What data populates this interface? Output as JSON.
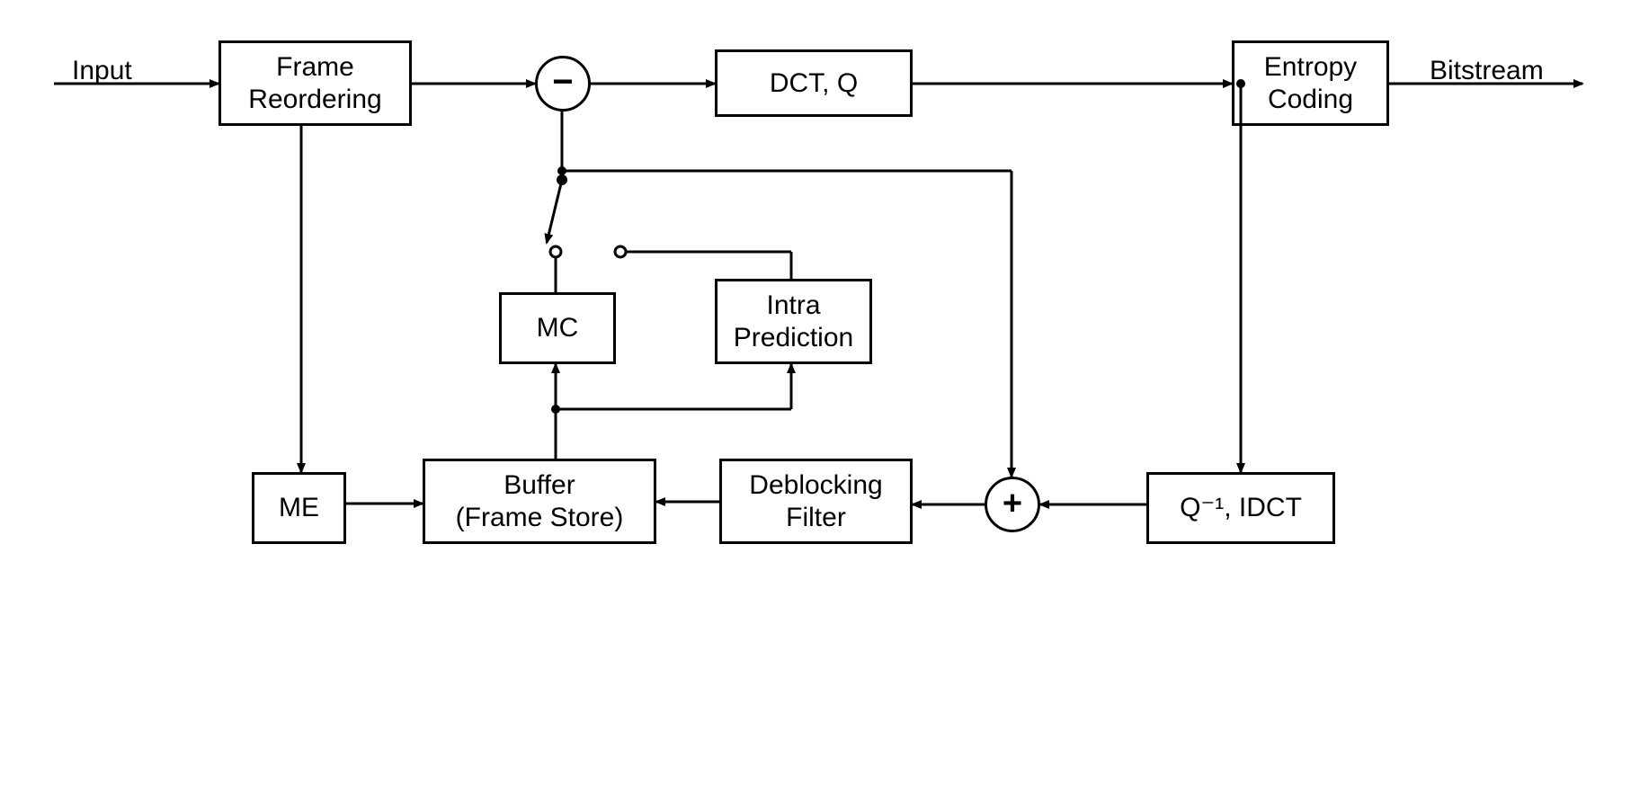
{
  "labels": {
    "input": "Input",
    "bitstream": "Bitstream"
  },
  "blocks": {
    "frameReordering": "Frame\nReordering",
    "dctQ": "DCT, Q",
    "entropyCoding": "Entropy\nCoding",
    "mc": "MC",
    "intraPrediction": "Intra\nPrediction",
    "me": "ME",
    "buffer": "Buffer\n(Frame Store)",
    "deblocking": "Deblocking\nFilter",
    "iqIdct": "Q⁻¹, IDCT"
  },
  "ops": {
    "minus": "−",
    "plus": "+"
  }
}
